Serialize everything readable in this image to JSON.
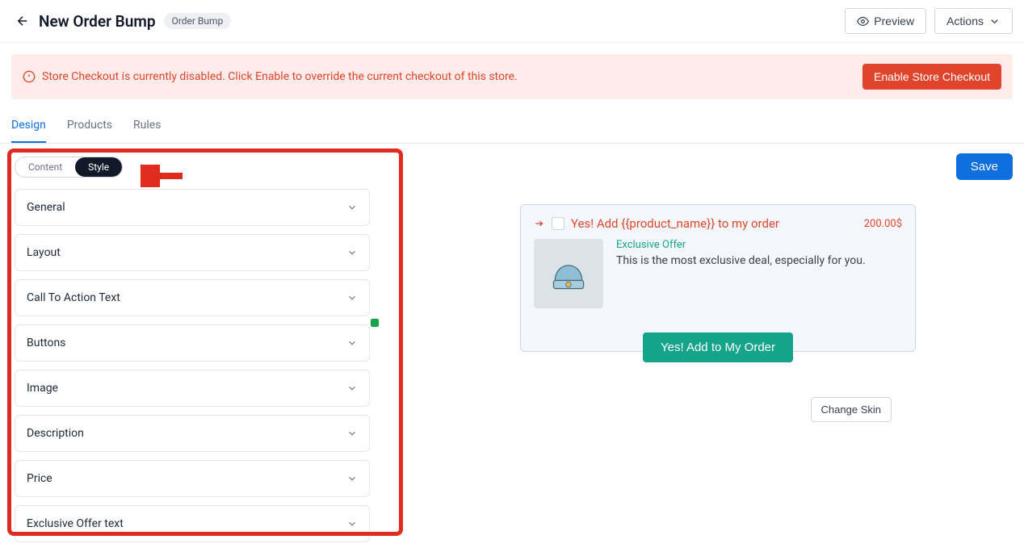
{
  "header": {
    "title": "New Order Bump",
    "badge": "Order Bump",
    "preview_label": "Preview",
    "actions_label": "Actions"
  },
  "alert": {
    "text": "Store Checkout is currently disabled. Click Enable to override the current checkout of this store.",
    "button": "Enable Store Checkout"
  },
  "tabs": [
    {
      "label": "Design",
      "active": true
    },
    {
      "label": "Products",
      "active": false
    },
    {
      "label": "Rules",
      "active": false
    }
  ],
  "segmented": {
    "content": "Content",
    "style": "Style"
  },
  "accordion": [
    "General",
    "Layout",
    "Call To Action Text",
    "Buttons",
    "Image",
    "Description",
    "Price",
    "Exclusive Offer text"
  ],
  "save_label": "Save",
  "bump": {
    "title": "Yes! Add {{product_name}} to my order",
    "price": "200.00$",
    "exclusive": "Exclusive Offer",
    "description": "This is the most exclusive deal, especially for you.",
    "cta": "Yes! Add to My Order"
  },
  "change_skin": "Change Skin"
}
